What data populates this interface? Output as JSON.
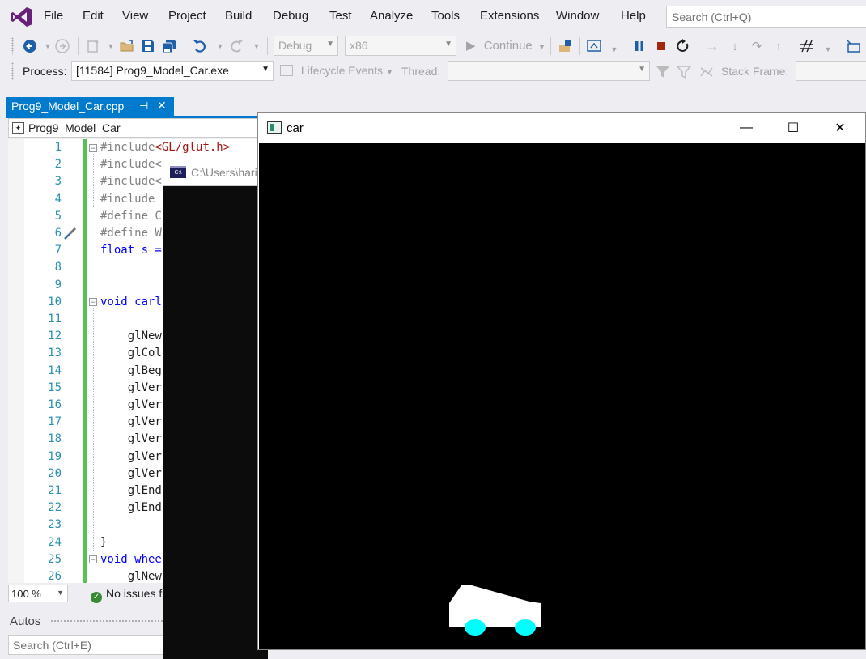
{
  "menu": {
    "items": [
      "File",
      "Edit",
      "View",
      "Project",
      "Build",
      "Debug",
      "Test",
      "Analyze",
      "Tools",
      "Extensions",
      "Window",
      "Help"
    ],
    "search_placeholder": "Search (Ctrl+Q)"
  },
  "toolbar": {
    "config": "Debug",
    "platform": "x86",
    "continue_label": "Continue",
    "process_label": "Process:",
    "process_value": "[11584] Prog9_Model_Car.exe",
    "lifecycle_label": "Lifecycle Events",
    "thread_label": "Thread:",
    "stack_frame_label": "Stack Frame:"
  },
  "document": {
    "tab_name": "Prog9_Model_Car.cpp",
    "nav_scope": "Prog9_Model_Car"
  },
  "editor": {
    "lines": [
      {
        "n": "1",
        "text": "#include<GL/glut.h>"
      },
      {
        "n": "2",
        "text": "#include<"
      },
      {
        "n": "3",
        "text": "#include<"
      },
      {
        "n": "4",
        "text": "#include"
      },
      {
        "n": "5",
        "text": "#define C"
      },
      {
        "n": "6",
        "text": "#define W"
      },
      {
        "n": "7",
        "text": "float s ="
      },
      {
        "n": "8",
        "text": ""
      },
      {
        "n": "9",
        "text": ""
      },
      {
        "n": "10",
        "text": "void carl"
      },
      {
        "n": "11",
        "text": ""
      },
      {
        "n": "12",
        "text": "    glNew"
      },
      {
        "n": "13",
        "text": "    glCol"
      },
      {
        "n": "14",
        "text": "    glBeg"
      },
      {
        "n": "15",
        "text": "    glVer"
      },
      {
        "n": "16",
        "text": "    glVer"
      },
      {
        "n": "17",
        "text": "    glVer"
      },
      {
        "n": "18",
        "text": "    glVer"
      },
      {
        "n": "19",
        "text": "    glVer"
      },
      {
        "n": "20",
        "text": "    glVer"
      },
      {
        "n": "21",
        "text": "    glEnd"
      },
      {
        "n": "22",
        "text": "    glEnd"
      },
      {
        "n": "23",
        "text": ""
      },
      {
        "n": "24",
        "text": "}"
      },
      {
        "n": "25",
        "text": "void whee"
      },
      {
        "n": "26",
        "text": "    glNew"
      }
    ]
  },
  "status": {
    "zoom": "100 %",
    "issues": "No issues f"
  },
  "autos": {
    "title": "Autos",
    "search_placeholder": "Search (Ctrl+E)"
  },
  "console": {
    "title": "C:\\Users\\hari"
  },
  "car_window": {
    "title": "car",
    "minimize": "—",
    "maximize": "☐",
    "close": "✕",
    "body_color": "#ffffff",
    "wheel_color": "#00ffff",
    "background_color": "#000000"
  }
}
